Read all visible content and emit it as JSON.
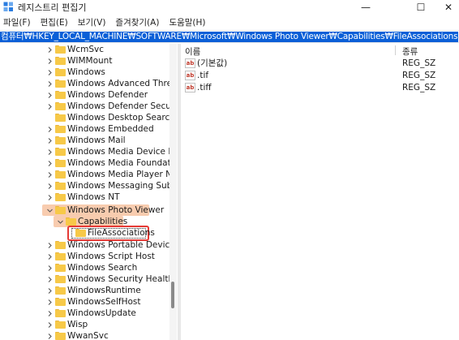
{
  "window": {
    "title": "레지스트리 편집기",
    "icon": "registry-editor-icon",
    "min_glyph": "—",
    "max_glyph": "☐",
    "close_glyph": "✕"
  },
  "menu": [
    "파일(F)",
    "편집(E)",
    "보기(V)",
    "즐겨찾기(A)",
    "도움말(H)"
  ],
  "address": "컴퓨터₩HKEY_LOCAL_MACHINE₩SOFTWARE₩Microsoft₩Windows Photo Viewer₩Capabilities₩FileAssociations",
  "tree": [
    {
      "label": "WcmSvc"
    },
    {
      "label": "WIMMount"
    },
    {
      "label": "Windows"
    },
    {
      "label": "Windows Advanced Threat P"
    },
    {
      "label": "Windows Defender"
    },
    {
      "label": "Windows Defender Security"
    },
    {
      "label": "Windows Desktop Search"
    },
    {
      "label": "Windows Embedded"
    },
    {
      "label": "Windows Mail"
    },
    {
      "label": "Windows Media Device Mar"
    },
    {
      "label": "Windows Media Foundation"
    },
    {
      "label": "Windows Media Player NSS"
    },
    {
      "label": "Windows Messaging Subsys"
    },
    {
      "label": "Windows NT"
    },
    {
      "label": "Windows Photo Viewer"
    },
    {
      "label": "Capabilities"
    },
    {
      "label": "FileAssociations"
    },
    {
      "label": "Windows Portable Devices"
    },
    {
      "label": "Windows Script Host"
    },
    {
      "label": "Windows Search"
    },
    {
      "label": "Windows Security Health"
    },
    {
      "label": "WindowsRuntime"
    },
    {
      "label": "WindowsSelfHost"
    },
    {
      "label": "WindowsUpdate"
    },
    {
      "label": "Wisp"
    },
    {
      "label": "WwanSvc"
    }
  ],
  "list": {
    "columns": [
      "이름",
      "종류"
    ],
    "rows": [
      {
        "name": "(기본값)",
        "type": "REG_SZ",
        "icon": "ab"
      },
      {
        "name": ".tif",
        "type": "REG_SZ",
        "icon": "ab"
      },
      {
        "name": ".tiff",
        "type": "REG_SZ",
        "icon": "ab"
      }
    ]
  },
  "colors": {
    "address_highlight": "#0a5fd7",
    "tree_highlight": "#f7c6a6",
    "annotation_box": "#e53935",
    "folder": "#f7c948"
  }
}
